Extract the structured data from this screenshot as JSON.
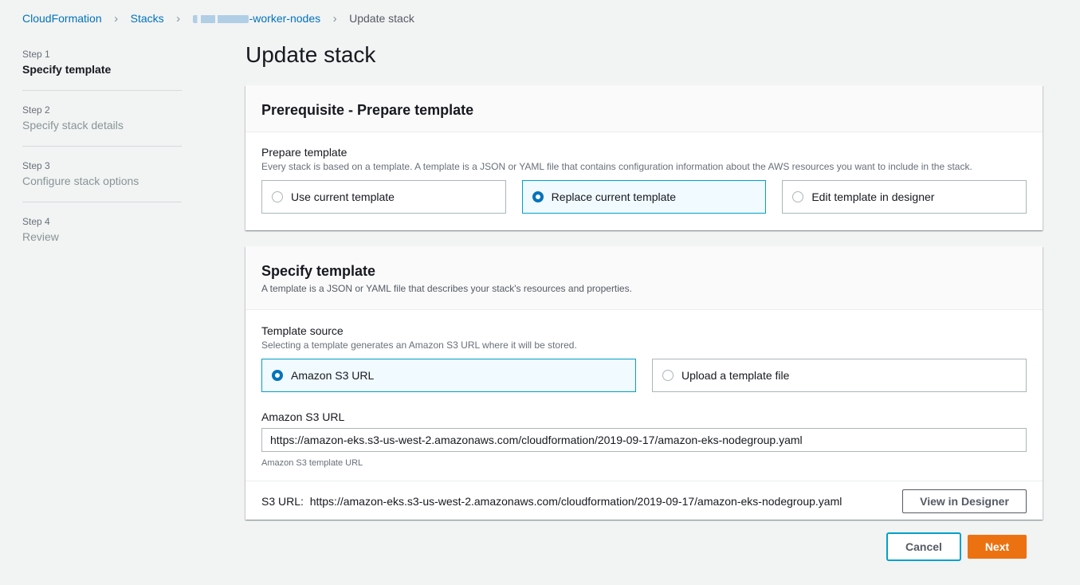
{
  "breadcrumb": {
    "items": [
      "CloudFormation",
      "Stacks",
      "-worker-nodes"
    ],
    "current": "Update stack",
    "separator": ">"
  },
  "steps": [
    {
      "num": "Step 1",
      "title": "Specify template",
      "active": true
    },
    {
      "num": "Step 2",
      "title": "Specify stack details",
      "active": false
    },
    {
      "num": "Step 3",
      "title": "Configure stack options",
      "active": false
    },
    {
      "num": "Step 4",
      "title": "Review",
      "active": false
    }
  ],
  "page_title": "Update stack",
  "prerequisite": {
    "header": "Prerequisite - Prepare template",
    "label": "Prepare template",
    "description": "Every stack is based on a template. A template is a JSON or YAML file that contains configuration information about the AWS resources you want to include in the stack.",
    "options": [
      {
        "label": "Use current template",
        "selected": false
      },
      {
        "label": "Replace current template",
        "selected": true
      },
      {
        "label": "Edit template in designer",
        "selected": false
      }
    ]
  },
  "specify": {
    "header": "Specify template",
    "header_desc": "A template is a JSON or YAML file that describes your stack's resources and properties.",
    "source_label": "Template source",
    "source_desc": "Selecting a template generates an Amazon S3 URL where it will be stored.",
    "options": [
      {
        "label": "Amazon S3 URL",
        "selected": true
      },
      {
        "label": "Upload a template file",
        "selected": false
      }
    ],
    "url_label": "Amazon S3 URL",
    "url_value": "https://amazon-eks.s3-us-west-2.amazonaws.com/cloudformation/2019-09-17/amazon-eks-nodegroup.yaml",
    "url_hint": "Amazon S3 template URL",
    "s3_prefix": "S3 URL:",
    "s3_url": "https://amazon-eks.s3-us-west-2.amazonaws.com/cloudformation/2019-09-17/amazon-eks-nodegroup.yaml",
    "designer_button": "View in Designer"
  },
  "actions": {
    "cancel": "Cancel",
    "next": "Next"
  },
  "colors": {
    "link": "#0073bb",
    "primary": "#ec7211",
    "selected_border": "#00a1c9",
    "selected_bg": "#f1faff"
  }
}
